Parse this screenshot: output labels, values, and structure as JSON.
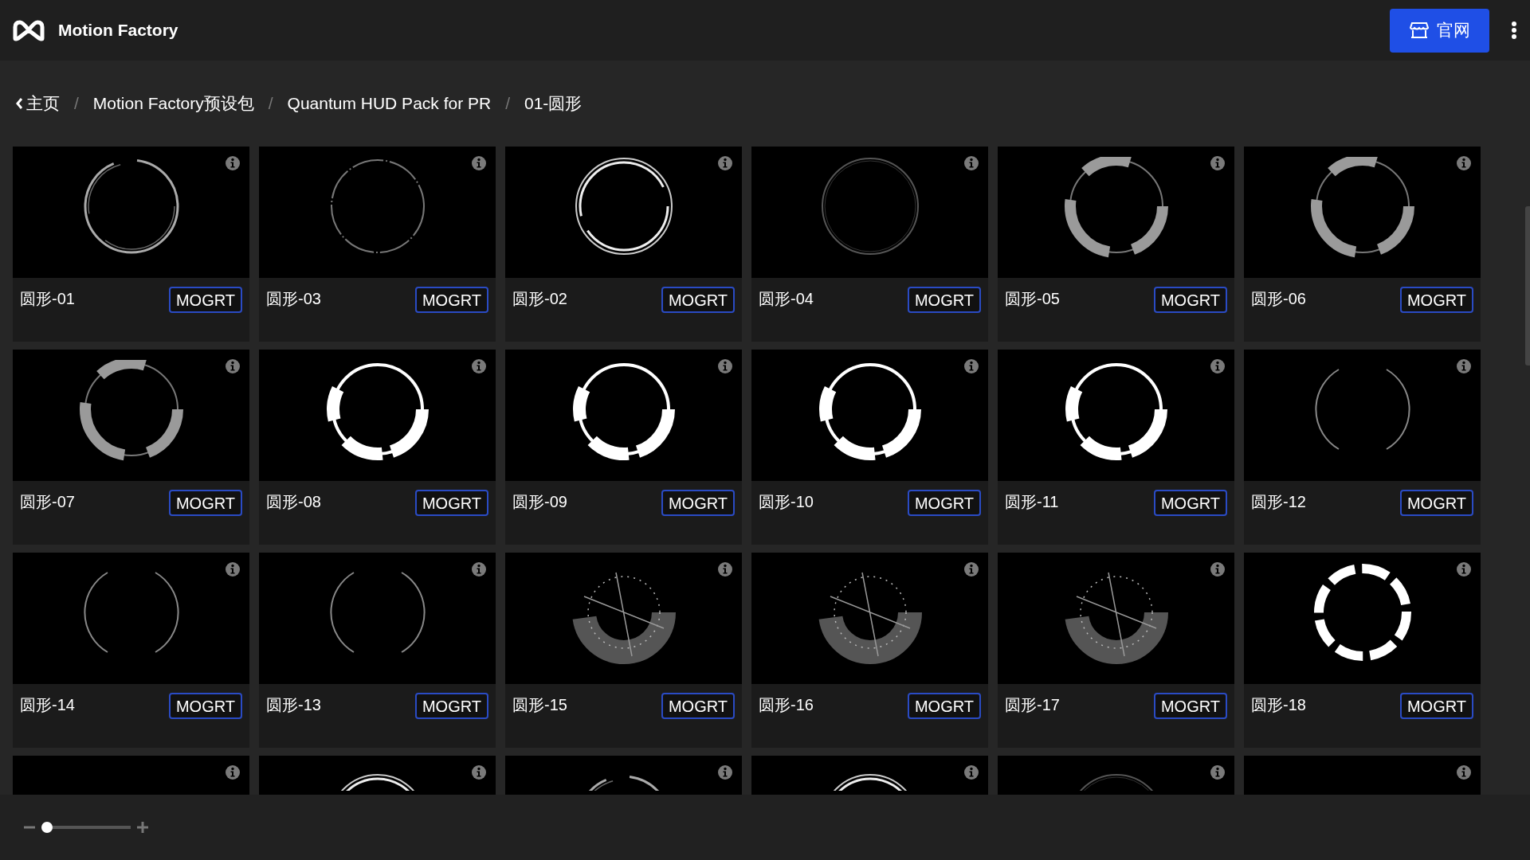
{
  "header": {
    "brand": "Motion Factory",
    "site_button": "官网"
  },
  "breadcrumb": [
    {
      "kind": "back",
      "label": "主页"
    },
    {
      "kind": "separator",
      "label": "/"
    },
    {
      "kind": "link",
      "label": "Motion Factory预设包"
    },
    {
      "kind": "separator",
      "label": "/"
    },
    {
      "kind": "link",
      "label": "Quantum HUD Pack for PR"
    },
    {
      "kind": "separator",
      "label": "/"
    },
    {
      "kind": "current",
      "label": "01-圆形"
    }
  ],
  "cards": [
    {
      "name": "圆形-01",
      "format": "MOGRT",
      "kind": "thin"
    },
    {
      "name": "圆形-03",
      "format": "MOGRT",
      "kind": "dotted"
    },
    {
      "name": "圆形-02",
      "format": "MOGRT",
      "kind": "double"
    },
    {
      "name": "圆形-04",
      "format": "MOGRT",
      "kind": "plain"
    },
    {
      "name": "圆形-05",
      "format": "MOGRT",
      "kind": "segmented"
    },
    {
      "name": "圆形-06",
      "format": "MOGRT",
      "kind": "segmented"
    },
    {
      "name": "圆形-07",
      "format": "MOGRT",
      "kind": "segmented"
    },
    {
      "name": "圆形-08",
      "format": "MOGRT",
      "kind": "bold"
    },
    {
      "name": "圆形-09",
      "format": "MOGRT",
      "kind": "bold"
    },
    {
      "name": "圆形-10",
      "format": "MOGRT",
      "kind": "bold"
    },
    {
      "name": "圆形-11",
      "format": "MOGRT",
      "kind": "bold"
    },
    {
      "name": "圆形-12",
      "format": "MOGRT",
      "kind": "brackets"
    },
    {
      "name": "圆形-14",
      "format": "MOGRT",
      "kind": "brackets"
    },
    {
      "name": "圆形-13",
      "format": "MOGRT",
      "kind": "brackets"
    },
    {
      "name": "圆形-15",
      "format": "MOGRT",
      "kind": "dial"
    },
    {
      "name": "圆形-16",
      "format": "MOGRT",
      "kind": "dial"
    },
    {
      "name": "圆形-17",
      "format": "MOGRT",
      "kind": "dial"
    },
    {
      "name": "圆形-18",
      "format": "MOGRT",
      "kind": "notched"
    }
  ],
  "cut_off_cards": [
    {
      "kind": "blank"
    },
    {
      "kind": "double"
    },
    {
      "kind": "thin"
    },
    {
      "kind": "double"
    },
    {
      "kind": "plain"
    },
    {
      "kind": "blank"
    }
  ],
  "zoom_slider": {
    "level": 0
  }
}
